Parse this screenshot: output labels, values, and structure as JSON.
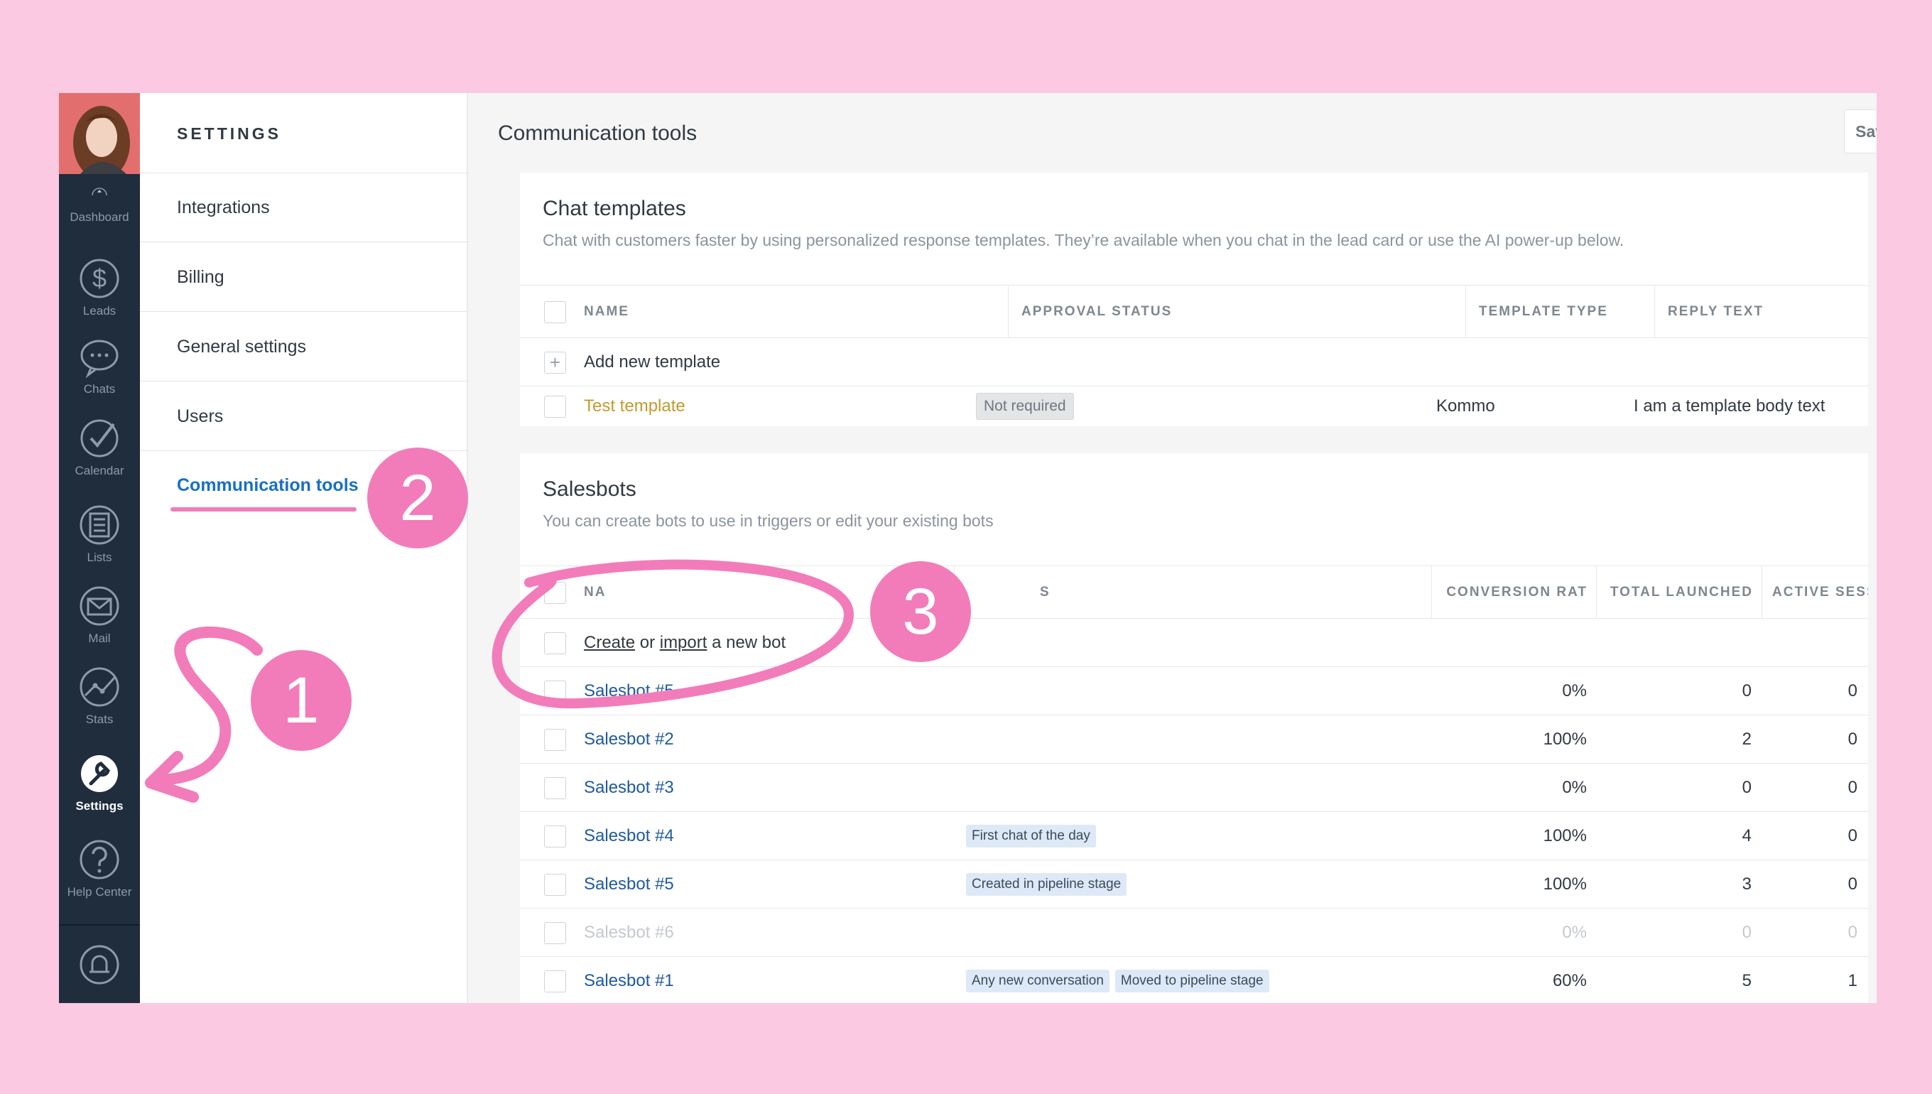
{
  "nav": {
    "items": [
      {
        "label": "Dashboard",
        "icon": "dashboard-icon"
      },
      {
        "label": "Leads",
        "icon": "dollar-icon"
      },
      {
        "label": "Chats",
        "icon": "chat-icon"
      },
      {
        "label": "Calendar",
        "icon": "check-icon"
      },
      {
        "label": "Lists",
        "icon": "list-icon"
      },
      {
        "label": "Mail",
        "icon": "mail-icon"
      },
      {
        "label": "Stats",
        "icon": "stats-icon"
      },
      {
        "label": "Settings",
        "icon": "wrench-icon"
      },
      {
        "label": "Help Center",
        "icon": "help-icon"
      }
    ],
    "active": "Settings"
  },
  "settings_menu": {
    "title": "SETTINGS",
    "items": [
      "Integrations",
      "Billing",
      "General settings",
      "Users",
      "Communication tools"
    ],
    "active": "Communication tools"
  },
  "main": {
    "title": "Communication tools",
    "save_label": "Save"
  },
  "chat_templates": {
    "title": "Chat templates",
    "description": "Chat with customers faster by using personalized response templates. They’re available when you chat in the lead card or use the AI power-up below.",
    "columns": [
      "NAME",
      "APPROVAL STATUS",
      "TEMPLATE TYPE",
      "REPLY TEXT"
    ],
    "add_label": "Add new template",
    "rows": [
      {
        "name": "Test template",
        "approval_status": "Not required",
        "template_type": "Kommo",
        "reply_text": "I am a template body text"
      }
    ]
  },
  "salesbots": {
    "title": "Salesbots",
    "description": "You can create bots to use in triggers or edit your existing bots",
    "columns": [
      "NA",
      "S",
      "CONVERSION RAT",
      "TOTAL LAUNCHED",
      "ACTIVE SESSION"
    ],
    "create": {
      "create": "Create",
      "or": "or",
      "import": "import",
      "rest": "a new bot"
    },
    "rows": [
      {
        "name": "Salesbot #5",
        "tags": [],
        "conversion": "0%",
        "launched": "0",
        "active": "0",
        "disabled": false
      },
      {
        "name": "Salesbot #2",
        "tags": [],
        "conversion": "100%",
        "launched": "2",
        "active": "0",
        "disabled": false
      },
      {
        "name": "Salesbot #3",
        "tags": [],
        "conversion": "0%",
        "launched": "0",
        "active": "0",
        "disabled": false
      },
      {
        "name": "Salesbot #4",
        "tags": [
          "First chat of the day"
        ],
        "conversion": "100%",
        "launched": "4",
        "active": "0",
        "disabled": false
      },
      {
        "name": "Salesbot #5",
        "tags": [
          "Created in pipeline stage"
        ],
        "conversion": "100%",
        "launched": "3",
        "active": "0",
        "disabled": false
      },
      {
        "name": "Salesbot #6",
        "tags": [],
        "conversion": "0%",
        "launched": "0",
        "active": "0",
        "disabled": true
      },
      {
        "name": "Salesbot #1",
        "tags": [
          "Any new conversation",
          "Moved to pipeline stage"
        ],
        "conversion": "60%",
        "launched": "5",
        "active": "1",
        "disabled": false
      }
    ]
  },
  "annotations": [
    "1",
    "2",
    "3"
  ],
  "colors": {
    "accent_pink": "#f27cba",
    "background": "#fcc9e2",
    "nav": "#1f2d3d",
    "link": "#1f5a9e",
    "active_menu": "#1a6fc4"
  }
}
